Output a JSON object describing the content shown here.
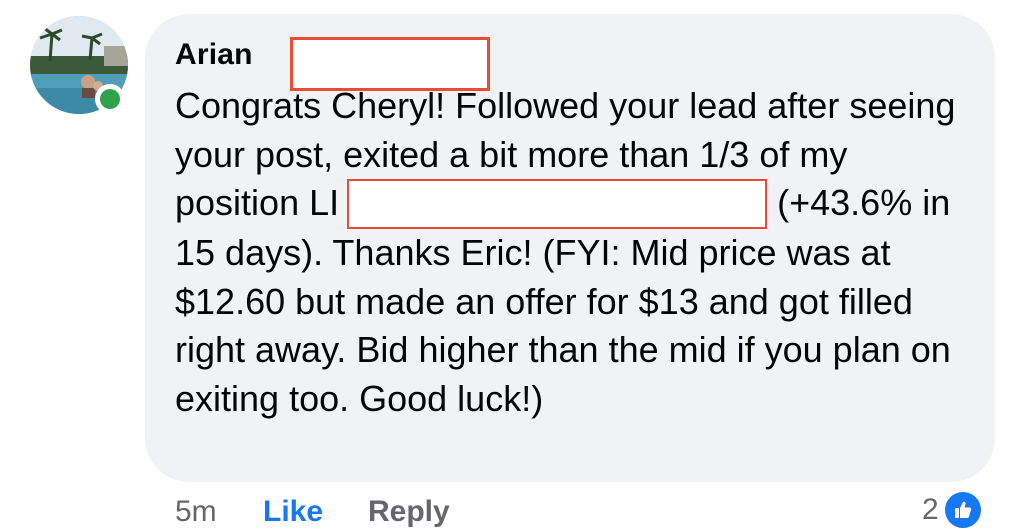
{
  "comment": {
    "author": "Arian",
    "text_before_redaction": "Congrats Cheryl! Followed your lead after seeing your post, exited a bit more than 1/3 of my position LI",
    "text_after_redaction": "(+43.6% in 15 days). Thanks Eric! (FYI: Mid price was at $12.60 but made an offer for $13 and got filled right away. Bid higher than the mid if you plan on exiting too. Good luck!)",
    "online_status": "online"
  },
  "actions": {
    "timestamp": "5m",
    "like_label": "Like",
    "reply_label": "Reply"
  },
  "reactions": {
    "count": "2",
    "icon": "thumbs-up-icon"
  },
  "colors": {
    "bubble": "#f0f2f5",
    "link_blue": "#1877f2",
    "muted": "#65676b",
    "online_green": "#31a24c",
    "redaction_border": "#e94b35"
  }
}
